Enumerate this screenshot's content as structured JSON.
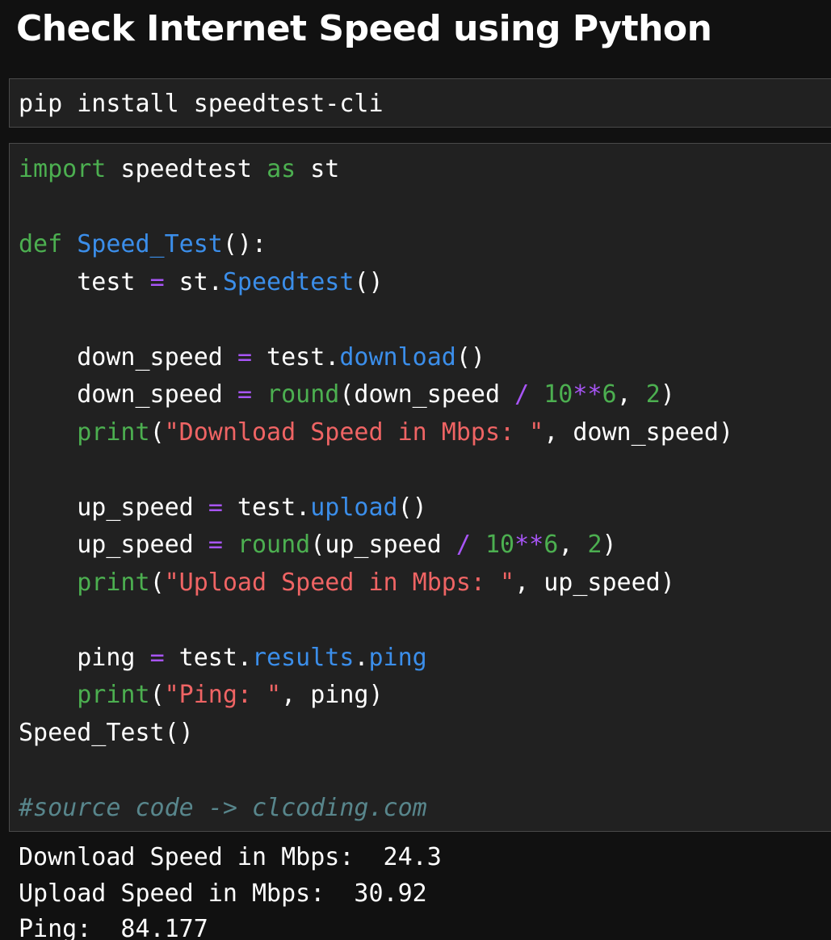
{
  "title": "Check Internet Speed using Python",
  "install_cell": {
    "command": "pip install speedtest-cli"
  },
  "code_cell": {
    "lines": [
      [
        {
          "t": "import",
          "c": "kw"
        },
        {
          "t": " speedtest ",
          "c": ""
        },
        {
          "t": "as",
          "c": "kw"
        },
        {
          "t": " st",
          "c": ""
        }
      ],
      [],
      [
        {
          "t": "def",
          "c": "kw"
        },
        {
          "t": " ",
          "c": ""
        },
        {
          "t": "Speed_Test",
          "c": "fn"
        },
        {
          "t": "():",
          "c": ""
        }
      ],
      [
        {
          "t": "    test ",
          "c": ""
        },
        {
          "t": "=",
          "c": "op"
        },
        {
          "t": " st.",
          "c": ""
        },
        {
          "t": "Speedtest",
          "c": "fn"
        },
        {
          "t": "()",
          "c": ""
        }
      ],
      [],
      [
        {
          "t": "    down_speed ",
          "c": ""
        },
        {
          "t": "=",
          "c": "op"
        },
        {
          "t": " test.",
          "c": ""
        },
        {
          "t": "download",
          "c": "fn"
        },
        {
          "t": "()",
          "c": ""
        }
      ],
      [
        {
          "t": "    down_speed ",
          "c": ""
        },
        {
          "t": "=",
          "c": "op"
        },
        {
          "t": " ",
          "c": ""
        },
        {
          "t": "round",
          "c": "kw"
        },
        {
          "t": "(down_speed ",
          "c": ""
        },
        {
          "t": "/",
          "c": "op"
        },
        {
          "t": " ",
          "c": ""
        },
        {
          "t": "10",
          "c": "num"
        },
        {
          "t": "**",
          "c": "op"
        },
        {
          "t": "6",
          "c": "num"
        },
        {
          "t": ", ",
          "c": ""
        },
        {
          "t": "2",
          "c": "num"
        },
        {
          "t": ")",
          "c": ""
        }
      ],
      [
        {
          "t": "    ",
          "c": ""
        },
        {
          "t": "print",
          "c": "kw"
        },
        {
          "t": "(",
          "c": ""
        },
        {
          "t": "\"Download Speed in Mbps: \"",
          "c": "str"
        },
        {
          "t": ", down_speed)",
          "c": ""
        }
      ],
      [],
      [
        {
          "t": "    up_speed ",
          "c": ""
        },
        {
          "t": "=",
          "c": "op"
        },
        {
          "t": " test.",
          "c": ""
        },
        {
          "t": "upload",
          "c": "fn"
        },
        {
          "t": "()",
          "c": ""
        }
      ],
      [
        {
          "t": "    up_speed ",
          "c": ""
        },
        {
          "t": "=",
          "c": "op"
        },
        {
          "t": " ",
          "c": ""
        },
        {
          "t": "round",
          "c": "kw"
        },
        {
          "t": "(up_speed ",
          "c": ""
        },
        {
          "t": "/",
          "c": "op"
        },
        {
          "t": " ",
          "c": ""
        },
        {
          "t": "10",
          "c": "num"
        },
        {
          "t": "**",
          "c": "op"
        },
        {
          "t": "6",
          "c": "num"
        },
        {
          "t": ", ",
          "c": ""
        },
        {
          "t": "2",
          "c": "num"
        },
        {
          "t": ")",
          "c": ""
        }
      ],
      [
        {
          "t": "    ",
          "c": ""
        },
        {
          "t": "print",
          "c": "kw"
        },
        {
          "t": "(",
          "c": ""
        },
        {
          "t": "\"Upload Speed in Mbps: \"",
          "c": "str"
        },
        {
          "t": ", up_speed)",
          "c": ""
        }
      ],
      [],
      [
        {
          "t": "    ping ",
          "c": ""
        },
        {
          "t": "=",
          "c": "op"
        },
        {
          "t": " test.",
          "c": ""
        },
        {
          "t": "results",
          "c": "fn"
        },
        {
          "t": ".",
          "c": ""
        },
        {
          "t": "ping",
          "c": "fn"
        }
      ],
      [
        {
          "t": "    ",
          "c": ""
        },
        {
          "t": "print",
          "c": "kw"
        },
        {
          "t": "(",
          "c": ""
        },
        {
          "t": "\"Ping: \"",
          "c": "str"
        },
        {
          "t": ", ping)",
          "c": ""
        }
      ],
      [
        {
          "t": "Speed_Test()",
          "c": ""
        }
      ],
      [],
      [
        {
          "t": "#source code -> clcoding.com",
          "c": "cm"
        }
      ]
    ]
  },
  "output": {
    "lines": [
      "Download Speed in Mbps:  24.3",
      "Upload Speed in Mbps:  30.92",
      "Ping:  84.177"
    ]
  },
  "colors": {
    "background": "#111111",
    "cell_background": "#212121",
    "keyword": "#4caf50",
    "function": "#3b8eea",
    "operator": "#a855f7",
    "string": "#ef6464",
    "comment": "#58868c"
  }
}
